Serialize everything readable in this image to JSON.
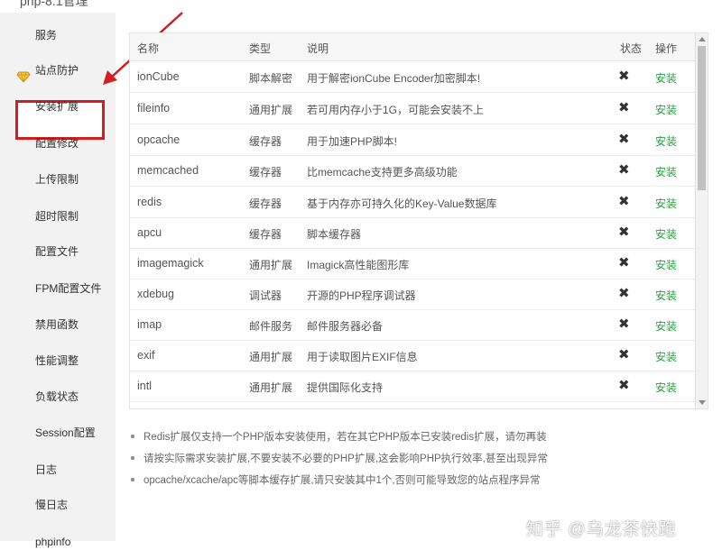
{
  "window": {
    "title": "php-8.1管理"
  },
  "sidebar": {
    "items": [
      {
        "label": "服务"
      },
      {
        "label": "站点防护",
        "icon": "diamond-icon"
      },
      {
        "label": "安装扩展",
        "active": true
      },
      {
        "label": "配置修改"
      },
      {
        "label": "上传限制"
      },
      {
        "label": "超时限制"
      },
      {
        "label": "配置文件"
      },
      {
        "label": "FPM配置文件"
      },
      {
        "label": "禁用函数"
      },
      {
        "label": "性能调整"
      },
      {
        "label": "负载状态"
      },
      {
        "label": "Session配置"
      },
      {
        "label": "日志"
      },
      {
        "label": "慢日志"
      },
      {
        "label": "phpinfo"
      }
    ]
  },
  "table": {
    "headers": {
      "name": "名称",
      "type": "类型",
      "desc": "说明",
      "status": "状态",
      "action": "操作"
    },
    "rows": [
      {
        "name": "ionCube",
        "type": "脚本解密",
        "desc": "用于解密ionCube Encoder加密脚本!",
        "status": "✖",
        "action": "安装"
      },
      {
        "name": "fileinfo",
        "type": "通用扩展",
        "desc": "若可用内存小于1G，可能会安装不上",
        "status": "✖",
        "action": "安装"
      },
      {
        "name": "opcache",
        "type": "缓存器",
        "desc": "用于加速PHP脚本!",
        "status": "✖",
        "action": "安装"
      },
      {
        "name": "memcached",
        "type": "缓存器",
        "desc": "比memcache支持更多高级功能",
        "status": "✖",
        "action": "安装"
      },
      {
        "name": "redis",
        "type": "缓存器",
        "desc": "基于内存亦可持久化的Key-Value数据库",
        "status": "✖",
        "action": "安装"
      },
      {
        "name": "apcu",
        "type": "缓存器",
        "desc": "脚本缓存器",
        "status": "✖",
        "action": "安装"
      },
      {
        "name": "imagemagick",
        "type": "通用扩展",
        "desc": "Imagick高性能图形库",
        "status": "✖",
        "action": "安装"
      },
      {
        "name": "xdebug",
        "type": "调试器",
        "desc": "开源的PHP程序调试器",
        "status": "✖",
        "action": "安装"
      },
      {
        "name": "imap",
        "type": "邮件服务",
        "desc": "邮件服务器必备",
        "status": "✖",
        "action": "安装"
      },
      {
        "name": "exif",
        "type": "通用扩展",
        "desc": "用于读取图片EXIF信息",
        "status": "✖",
        "action": "安装"
      },
      {
        "name": "intl",
        "type": "通用扩展",
        "desc": "提供国际化支持",
        "status": "✖",
        "action": "安装"
      }
    ]
  },
  "notes": [
    "Redis扩展仅支持一个PHP版本安装使用，若在其它PHP版本已安装redis扩展，请勿再装",
    "请按实际需求安装扩展,不要安装不必要的PHP扩展,这会影响PHP执行效率,甚至出现异常",
    "opcache/xcache/apc等脚本缓存扩展,请只安装其中1个,否则可能导致您的站点程序异常"
  ],
  "watermark": "知乎 @乌龙茶快跑",
  "colors": {
    "accent": "#20a53a",
    "highlight": "#d11f1f"
  }
}
